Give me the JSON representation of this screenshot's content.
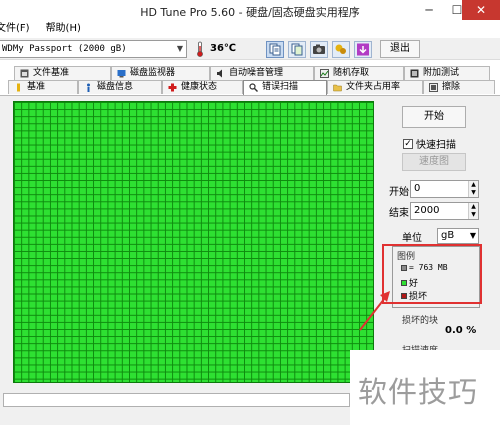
{
  "window": {
    "title": "HD Tune Pro 5.60 - 硬盘/固态硬盘实用程序"
  },
  "menu": {
    "items": [
      "文件(F)",
      "帮助(H)"
    ]
  },
  "toolbar": {
    "drive": "WDMy Passport (2000 gB)",
    "temperature": "36℃",
    "exit_label": "退出"
  },
  "tabs": {
    "row1": [
      "文件基准",
      "磁盘监视器",
      "自动噪音管理",
      "随机存取",
      "附加测试"
    ],
    "row2": [
      "基准",
      "磁盘信息",
      "健康状态",
      "错误扫描",
      "文件夹占用率",
      "擦除"
    ],
    "active": "错误扫描"
  },
  "controls": {
    "start_label": "开始",
    "quick_scan_label": "快速扫描",
    "quick_scan_checked": true,
    "speed_map_label": "速度图",
    "start_field_label": "开始",
    "start_value": "0",
    "end_field_label": "结束",
    "end_value": "2000",
    "unit_label": "单位",
    "unit_value": "gB"
  },
  "legend": {
    "title": "图例",
    "block_size": "= 763 MB",
    "good_label": "好",
    "bad_label": "损坏"
  },
  "stats": {
    "damaged_blocks_label": "损坏的块",
    "damaged_blocks_value": "0.0 %",
    "scan_speed_label": "扫描速度"
  },
  "watermark": "软件技巧",
  "colors": {
    "good": "#2ee032",
    "bad": "#b01818",
    "block": "#8a8a8a",
    "highlight": "#e03131"
  }
}
